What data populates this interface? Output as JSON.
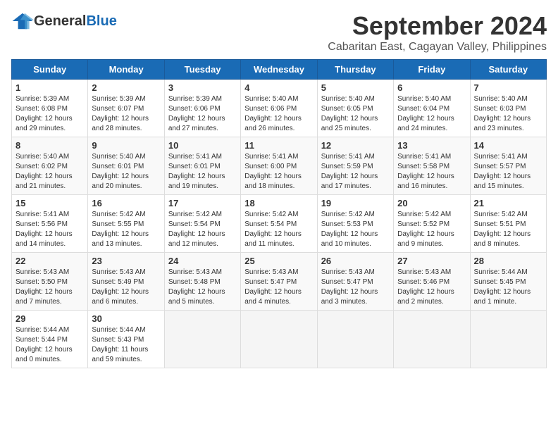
{
  "header": {
    "logo_general": "General",
    "logo_blue": "Blue",
    "month_title": "September 2024",
    "location": "Cabaritan East, Cagayan Valley, Philippines"
  },
  "days_of_week": [
    "Sunday",
    "Monday",
    "Tuesday",
    "Wednesday",
    "Thursday",
    "Friday",
    "Saturday"
  ],
  "weeks": [
    [
      {
        "day": "1",
        "sunrise": "Sunrise: 5:39 AM",
        "sunset": "Sunset: 6:08 PM",
        "daylight": "Daylight: 12 hours and 29 minutes."
      },
      {
        "day": "2",
        "sunrise": "Sunrise: 5:39 AM",
        "sunset": "Sunset: 6:07 PM",
        "daylight": "Daylight: 12 hours and 28 minutes."
      },
      {
        "day": "3",
        "sunrise": "Sunrise: 5:39 AM",
        "sunset": "Sunset: 6:06 PM",
        "daylight": "Daylight: 12 hours and 27 minutes."
      },
      {
        "day": "4",
        "sunrise": "Sunrise: 5:40 AM",
        "sunset": "Sunset: 6:06 PM",
        "daylight": "Daylight: 12 hours and 26 minutes."
      },
      {
        "day": "5",
        "sunrise": "Sunrise: 5:40 AM",
        "sunset": "Sunset: 6:05 PM",
        "daylight": "Daylight: 12 hours and 25 minutes."
      },
      {
        "day": "6",
        "sunrise": "Sunrise: 5:40 AM",
        "sunset": "Sunset: 6:04 PM",
        "daylight": "Daylight: 12 hours and 24 minutes."
      },
      {
        "day": "7",
        "sunrise": "Sunrise: 5:40 AM",
        "sunset": "Sunset: 6:03 PM",
        "daylight": "Daylight: 12 hours and 23 minutes."
      }
    ],
    [
      {
        "day": "8",
        "sunrise": "Sunrise: 5:40 AM",
        "sunset": "Sunset: 6:02 PM",
        "daylight": "Daylight: 12 hours and 21 minutes."
      },
      {
        "day": "9",
        "sunrise": "Sunrise: 5:40 AM",
        "sunset": "Sunset: 6:01 PM",
        "daylight": "Daylight: 12 hours and 20 minutes."
      },
      {
        "day": "10",
        "sunrise": "Sunrise: 5:41 AM",
        "sunset": "Sunset: 6:01 PM",
        "daylight": "Daylight: 12 hours and 19 minutes."
      },
      {
        "day": "11",
        "sunrise": "Sunrise: 5:41 AM",
        "sunset": "Sunset: 6:00 PM",
        "daylight": "Daylight: 12 hours and 18 minutes."
      },
      {
        "day": "12",
        "sunrise": "Sunrise: 5:41 AM",
        "sunset": "Sunset: 5:59 PM",
        "daylight": "Daylight: 12 hours and 17 minutes."
      },
      {
        "day": "13",
        "sunrise": "Sunrise: 5:41 AM",
        "sunset": "Sunset: 5:58 PM",
        "daylight": "Daylight: 12 hours and 16 minutes."
      },
      {
        "day": "14",
        "sunrise": "Sunrise: 5:41 AM",
        "sunset": "Sunset: 5:57 PM",
        "daylight": "Daylight: 12 hours and 15 minutes."
      }
    ],
    [
      {
        "day": "15",
        "sunrise": "Sunrise: 5:41 AM",
        "sunset": "Sunset: 5:56 PM",
        "daylight": "Daylight: 12 hours and 14 minutes."
      },
      {
        "day": "16",
        "sunrise": "Sunrise: 5:42 AM",
        "sunset": "Sunset: 5:55 PM",
        "daylight": "Daylight: 12 hours and 13 minutes."
      },
      {
        "day": "17",
        "sunrise": "Sunrise: 5:42 AM",
        "sunset": "Sunset: 5:54 PM",
        "daylight": "Daylight: 12 hours and 12 minutes."
      },
      {
        "day": "18",
        "sunrise": "Sunrise: 5:42 AM",
        "sunset": "Sunset: 5:54 PM",
        "daylight": "Daylight: 12 hours and 11 minutes."
      },
      {
        "day": "19",
        "sunrise": "Sunrise: 5:42 AM",
        "sunset": "Sunset: 5:53 PM",
        "daylight": "Daylight: 12 hours and 10 minutes."
      },
      {
        "day": "20",
        "sunrise": "Sunrise: 5:42 AM",
        "sunset": "Sunset: 5:52 PM",
        "daylight": "Daylight: 12 hours and 9 minutes."
      },
      {
        "day": "21",
        "sunrise": "Sunrise: 5:42 AM",
        "sunset": "Sunset: 5:51 PM",
        "daylight": "Daylight: 12 hours and 8 minutes."
      }
    ],
    [
      {
        "day": "22",
        "sunrise": "Sunrise: 5:43 AM",
        "sunset": "Sunset: 5:50 PM",
        "daylight": "Daylight: 12 hours and 7 minutes."
      },
      {
        "day": "23",
        "sunrise": "Sunrise: 5:43 AM",
        "sunset": "Sunset: 5:49 PM",
        "daylight": "Daylight: 12 hours and 6 minutes."
      },
      {
        "day": "24",
        "sunrise": "Sunrise: 5:43 AM",
        "sunset": "Sunset: 5:48 PM",
        "daylight": "Daylight: 12 hours and 5 minutes."
      },
      {
        "day": "25",
        "sunrise": "Sunrise: 5:43 AM",
        "sunset": "Sunset: 5:47 PM",
        "daylight": "Daylight: 12 hours and 4 minutes."
      },
      {
        "day": "26",
        "sunrise": "Sunrise: 5:43 AM",
        "sunset": "Sunset: 5:47 PM",
        "daylight": "Daylight: 12 hours and 3 minutes."
      },
      {
        "day": "27",
        "sunrise": "Sunrise: 5:43 AM",
        "sunset": "Sunset: 5:46 PM",
        "daylight": "Daylight: 12 hours and 2 minutes."
      },
      {
        "day": "28",
        "sunrise": "Sunrise: 5:44 AM",
        "sunset": "Sunset: 5:45 PM",
        "daylight": "Daylight: 12 hours and 1 minute."
      }
    ],
    [
      {
        "day": "29",
        "sunrise": "Sunrise: 5:44 AM",
        "sunset": "Sunset: 5:44 PM",
        "daylight": "Daylight: 12 hours and 0 minutes."
      },
      {
        "day": "30",
        "sunrise": "Sunrise: 5:44 AM",
        "sunset": "Sunset: 5:43 PM",
        "daylight": "Daylight: 11 hours and 59 minutes."
      },
      null,
      null,
      null,
      null,
      null
    ]
  ]
}
